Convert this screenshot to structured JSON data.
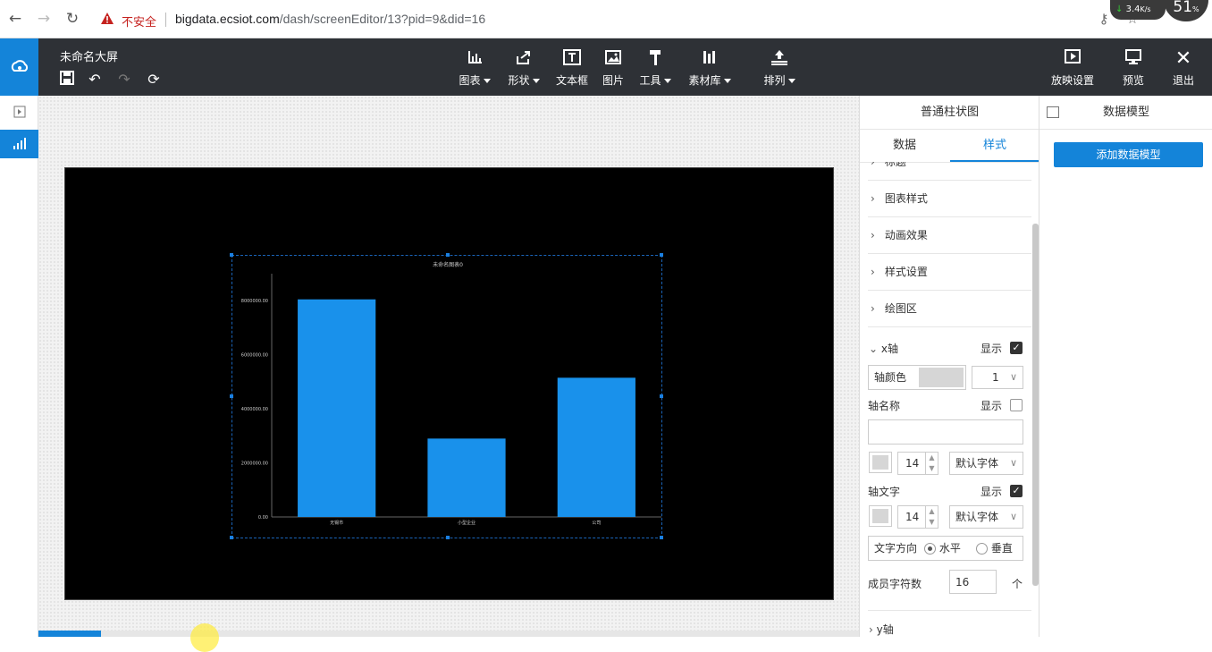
{
  "browser": {
    "insecure_label": "不安全",
    "url_host": "bigdata.ecsiot.com",
    "url_path": "/dash/screenEditor/13?pid=9&did=16",
    "net_speed": "3.4",
    "net_speed_unit": "K/s",
    "cpu": "51",
    "cpu_unit": "%"
  },
  "app": {
    "title": "未命名大屏",
    "toolbar": [
      {
        "label": "图表",
        "icon": "bar-chart-icon",
        "dropdown": true
      },
      {
        "label": "形状",
        "icon": "shape-icon",
        "dropdown": true
      },
      {
        "label": "文本框",
        "icon": "text-box-icon",
        "dropdown": false
      },
      {
        "label": "图片",
        "icon": "image-icon",
        "dropdown": false
      },
      {
        "label": "工具",
        "icon": "hammer-icon",
        "dropdown": true
      },
      {
        "label": "素材库",
        "icon": "library-icon",
        "dropdown": true
      },
      {
        "label": "排列",
        "icon": "arrange-icon",
        "dropdown": true
      }
    ],
    "right_actions": [
      {
        "label": "放映设置",
        "icon": "play-icon"
      },
      {
        "label": "预览",
        "icon": "preview-icon"
      },
      {
        "label": "退出",
        "icon": "close-icon"
      }
    ]
  },
  "chart_data": {
    "type": "bar",
    "title": "未命名图表0",
    "categories": [
      "无锡市",
      "小型企业",
      "公司"
    ],
    "values": [
      8050000,
      2900000,
      5150000
    ],
    "ylim": [
      0,
      9000000
    ],
    "yticks": [
      "0.00",
      "2000000.00",
      "4000000.00",
      "6000000.00",
      "8000000.00"
    ],
    "ytick_values": [
      0,
      2000000,
      4000000,
      6000000,
      8000000
    ],
    "bar_color": "#1991eb",
    "grid": false
  },
  "panel": {
    "title": "普通柱状图",
    "tabs": [
      "数据",
      "样式"
    ],
    "active_tab": "样式",
    "sections": [
      "标题",
      "图表样式",
      "动画效果",
      "样式设置",
      "绘图区"
    ],
    "xaxis": {
      "label": "x轴",
      "show_label": "显示",
      "show": true,
      "axis_color_label": "轴颜色",
      "axis_width": "1",
      "axis_name_label": "轴名称",
      "axis_name_show": false,
      "axis_name_value": "",
      "name_font_size": "14",
      "name_font": "默认字体",
      "axis_text_label": "轴文字",
      "axis_text_show": true,
      "text_font_size": "14",
      "text_font": "默认字体",
      "direction_label": "文字方向",
      "dir_horizontal": "水平",
      "dir_vertical": "垂直",
      "direction": "水平",
      "member_chars_label": "成员字符数",
      "member_chars": "16",
      "member_chars_unit": "个"
    },
    "yaxis_label": "y轴"
  },
  "model_panel": {
    "title": "数据模型",
    "add_button": "添加数据模型"
  }
}
